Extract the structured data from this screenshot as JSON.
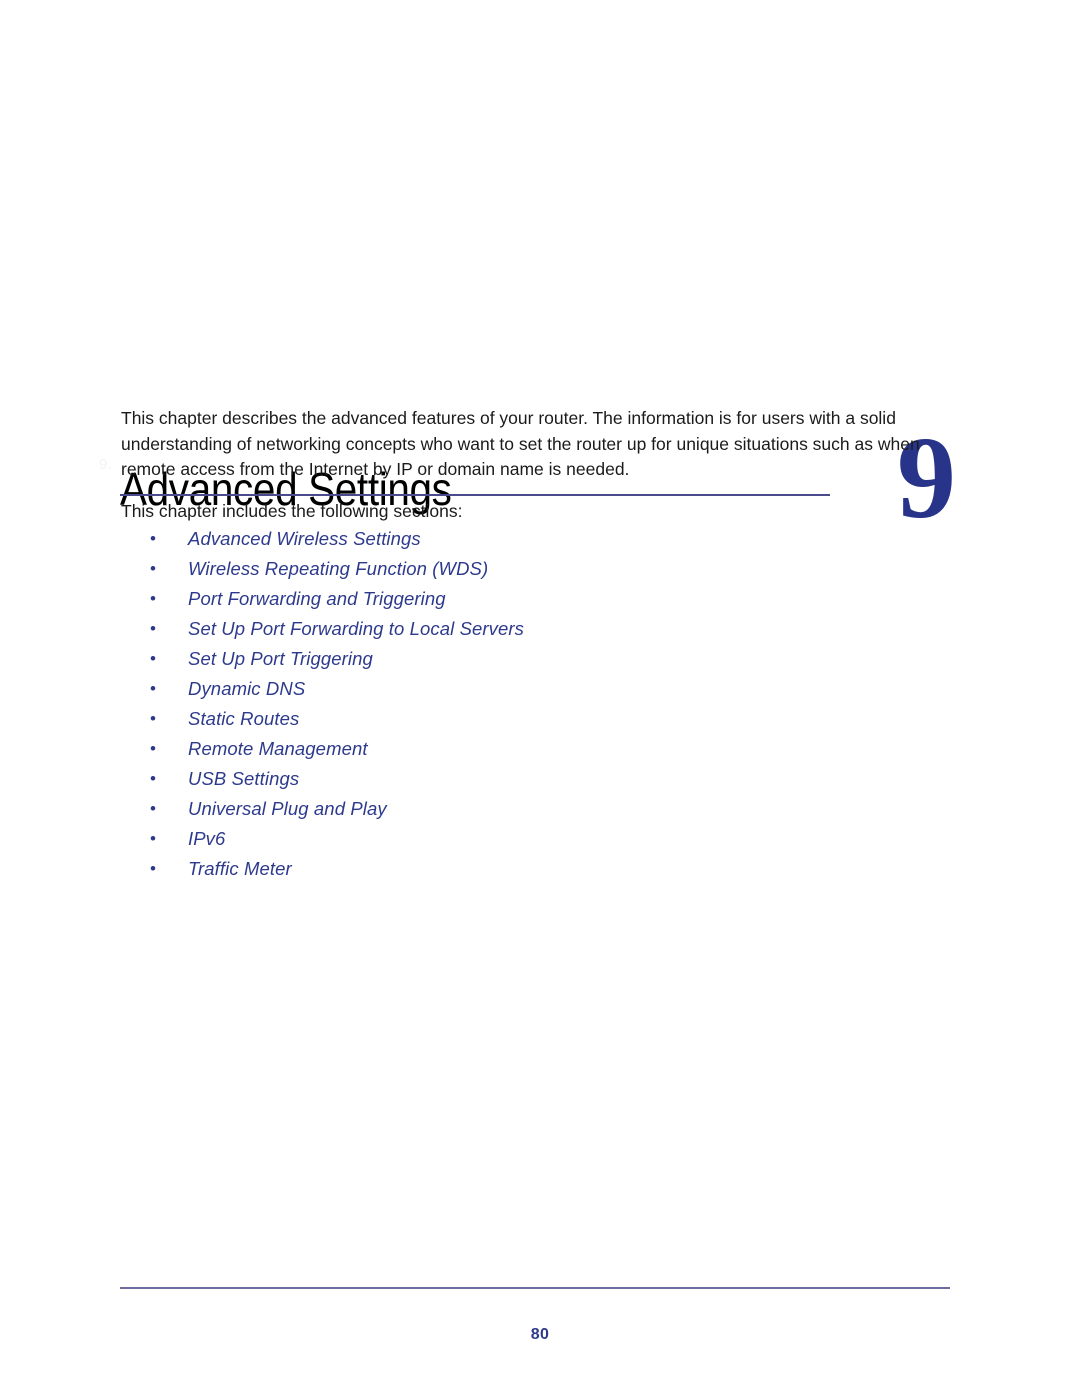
{
  "chapter": {
    "marker": "9.",
    "title": "Advanced Settings",
    "number": "9",
    "rule_color": "#4a4a8c",
    "number_color": "#28348a"
  },
  "body": {
    "paragraph_1": "This chapter describes the advanced features of your router. The information is for users with a solid understanding of networking concepts who want to set the router up for unique situations such as when remote access from the Internet by IP or domain name is needed.",
    "paragraph_2": "This chapter includes the following sections:"
  },
  "sections": {
    "bullet_glyph": "•",
    "link_color": "#2d3a8c",
    "items": [
      {
        "label": "Advanced Wireless Settings"
      },
      {
        "label": "Wireless Repeating Function (WDS)"
      },
      {
        "label": "Port Forwarding and Triggering"
      },
      {
        "label": "Set Up Port Forwarding to Local Servers"
      },
      {
        "label": "Set Up Port Triggering"
      },
      {
        "label": "Dynamic DNS"
      },
      {
        "label": "Static Routes"
      },
      {
        "label": "Remote Management"
      },
      {
        "label": "USB Settings"
      },
      {
        "label": "Universal Plug and Play"
      },
      {
        "label": "IPv6"
      },
      {
        "label": "Traffic Meter"
      }
    ]
  },
  "footer": {
    "page_number": "80",
    "rule_color": "#6b6b9e"
  }
}
